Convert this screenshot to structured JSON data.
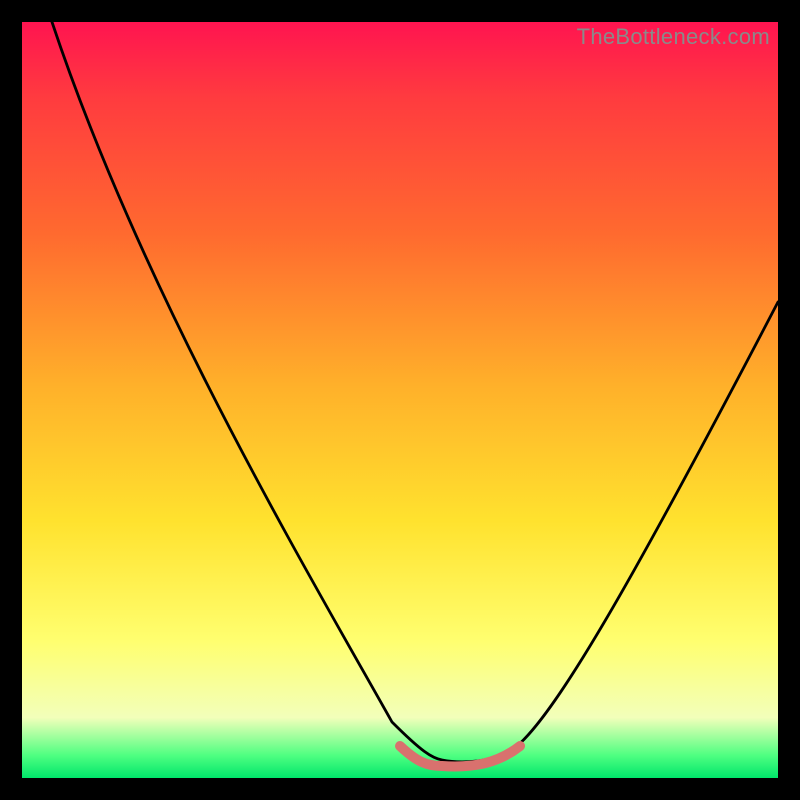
{
  "watermark": "TheBottleneck.com",
  "chart_data": {
    "type": "line",
    "title": "",
    "xlabel": "",
    "ylabel": "",
    "xlim": [
      0,
      100
    ],
    "ylim": [
      0,
      100
    ],
    "series": [
      {
        "name": "bottleneck-curve",
        "x": [
          0,
          10,
          20,
          30,
          40,
          45,
          50,
          52,
          55,
          58,
          60,
          62,
          65,
          70,
          80,
          90,
          100
        ],
        "values": [
          100,
          84,
          67,
          50,
          32,
          22,
          10,
          4,
          1,
          1,
          1,
          3,
          8,
          16,
          33,
          48,
          63
        ]
      },
      {
        "name": "optimal-band",
        "x": [
          52,
          55,
          58,
          60,
          62,
          64
        ],
        "values": [
          3,
          1,
          1,
          1,
          2,
          3
        ]
      }
    ],
    "background_gradient_stops": [
      {
        "pos": 0.0,
        "color": "#ff1450"
      },
      {
        "pos": 0.3,
        "color": "#ff6a2f"
      },
      {
        "pos": 0.55,
        "color": "#ffd22a"
      },
      {
        "pos": 0.8,
        "color": "#ffff70"
      },
      {
        "pos": 0.95,
        "color": "#8fff9a"
      },
      {
        "pos": 1.0,
        "color": "#00e66b"
      }
    ]
  }
}
